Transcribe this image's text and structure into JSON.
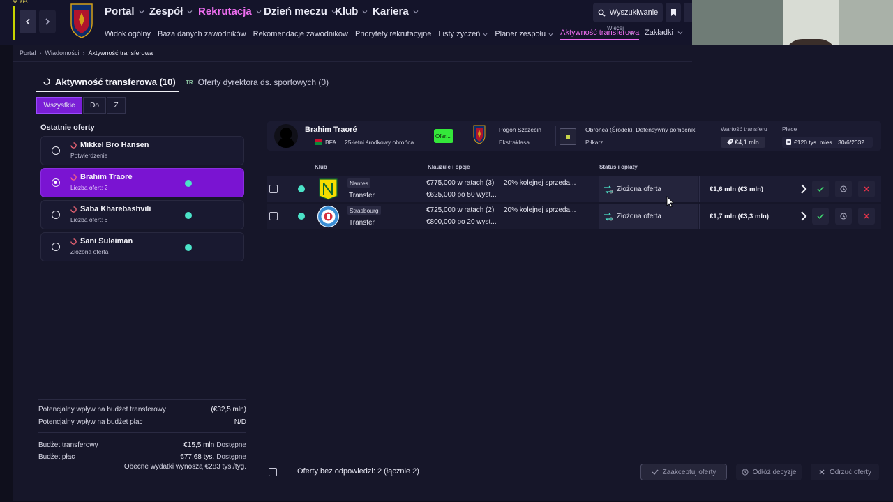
{
  "overlay": {
    "fps": "30 FPS"
  },
  "nav": {
    "main": [
      {
        "label": "Portal",
        "active": false
      },
      {
        "label": "Zespół",
        "active": false
      },
      {
        "label": "Rekrutacja",
        "active": true
      },
      {
        "label": "Dzień meczu",
        "active": false
      },
      {
        "label": "Klub",
        "active": false
      },
      {
        "label": "Kariera",
        "active": false
      }
    ],
    "sub": [
      {
        "label": "Widok ogólny"
      },
      {
        "label": "Baza danych zawodników"
      },
      {
        "label": "Rekomendacje zawodników"
      },
      {
        "label": "Priorytety rekrutacyjne"
      },
      {
        "label": "Listy życzeń"
      },
      {
        "label": "Planer zespołu"
      },
      {
        "label": "Aktywność transferowa"
      }
    ],
    "more_label": "Więcej",
    "bookmarks_label": "Zakładki",
    "search_label": "Wyszukiwanie",
    "icons": [
      "chevron-left-icon",
      "chevron-right-icon",
      "search-icon",
      "bookmark-icon"
    ]
  },
  "breadcrumb": {
    "items": [
      "Portal",
      "Wiadomości",
      "Aktywność transferowa"
    ]
  },
  "tabs": {
    "transfer_activity": "Aktywność transferowa (10)",
    "director_offers_prefix": "TR",
    "director_offers": "Oferty dyrektora ds. sportowych (0)"
  },
  "filters": {
    "all": "Wszystkie",
    "to": "Do",
    "from": "Z"
  },
  "recent": {
    "title": "Ostatnie oferty",
    "items": [
      {
        "name": "Mikkel Bro Hansen",
        "sub": "Potwierdzenie",
        "selected": false,
        "dot": false
      },
      {
        "name": "Brahim Traoré",
        "sub": "Liczba ofert: 2",
        "selected": true,
        "dot": true
      },
      {
        "name": "Saba Kharebashvili",
        "sub": "Liczba ofert: 6",
        "selected": false,
        "dot": true
      },
      {
        "name": "Sani Suleiman",
        "sub": "Złożona oferta",
        "selected": false,
        "dot": true
      }
    ]
  },
  "budget": {
    "transfer_impact_label": "Potencjalny wpływ na budżet transferowy",
    "transfer_impact_value": "(€32,5 mln)",
    "wage_impact_label": "Potencjalny wpływ na budżet płac",
    "wage_impact_value": "N/D",
    "transfer_budget_label": "Budżet transferowy",
    "transfer_budget_value": "€15,5 mln",
    "transfer_budget_note": "Dostępne",
    "wage_budget_label": "Budżet płac",
    "wage_budget_value": "€77,68 tys.",
    "wage_budget_note": "Dostępne",
    "current_expenses": "Obecne wydatki wynoszą €283 tys./tyg."
  },
  "player": {
    "name": "Brahim Traoré",
    "nationality": "BFA",
    "description": "25-letni środkowy obrońca",
    "badge": "Ofer...",
    "club": "Pogoń Szczecin",
    "league": "Ekstraklasa",
    "positions": "Obrońca (Środek), Defensywny pomocnik",
    "role": "Piłkarz",
    "transfer_value_label": "Wartość transferu",
    "transfer_value": "€4,1 mln",
    "wage_label": "Płace",
    "wage": "€120 tys. mies.",
    "contract_end": "30/6/2032"
  },
  "table": {
    "headers": {
      "club": "Klub",
      "clauses": "Klauzule i opcje",
      "status": "Status i opłaty"
    },
    "rows": [
      {
        "club": "Nantes",
        "type": "Transfer",
        "clause1": "€775,000 w ratach (3)",
        "clause2": "€625,000 po 50 wyst...",
        "clause3": "20% kolejnej sprzeda...",
        "status": "Złożona oferta",
        "fee": "€1,6 mln (€3 mln)",
        "crest_color": "#f5dc00"
      },
      {
        "club": "Strasbourg",
        "type": "Transfer",
        "clause1": "€725,000 w ratach (2)",
        "clause2": "€800,000 po 20 wyst...",
        "clause3": "20% kolejnej sprzeda...",
        "status": "Złożona oferta",
        "fee": "€1,7 mln (€3,3 mln)",
        "crest_color": "#3b8fd6"
      }
    ]
  },
  "bottom": {
    "unanswered": "Oferty bez odpowiedzi: 2 (łącznie 2)",
    "accept": "Zaakceptuj oferty",
    "delay": "Odłóż decyzje",
    "reject": "Odrzuć oferty"
  },
  "colors": {
    "accent_purple": "#7a14d2",
    "active_nav": "#ee6ef0",
    "status_dot": "#4be3c8",
    "accept_green": "#3ed36e",
    "reject_red": "#e8334a"
  }
}
